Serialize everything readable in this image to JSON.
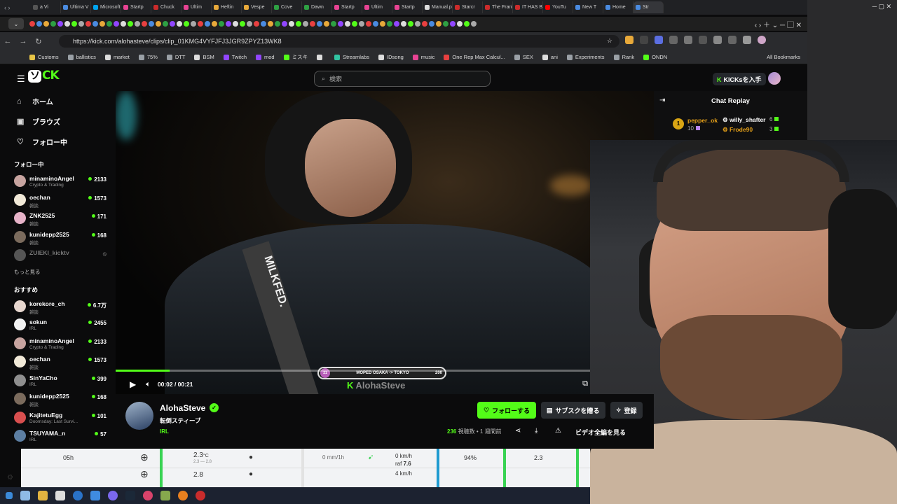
{
  "outer_tabs": [
    "a Vi",
    "Ultima V",
    "Microsoft",
    "Startp",
    "Chuck",
    "Ultim",
    "Heftin",
    "Vespe",
    "Cove",
    "Dawn",
    "Startp",
    "Ultim",
    "Startp",
    "Manual.p",
    "Starcr",
    "The Frank",
    "IT HAS B",
    "YouTu",
    "New T",
    "Home",
    "Str"
  ],
  "url": "https://kick.com/alohasteve/clips/clip_01KMG4VYFJFJ3JGR9ZPYZ13WK8",
  "bookmarks": [
    {
      "label": "Customs",
      "color": "#e8c547"
    },
    {
      "label": "ballistics",
      "color": "#9aa0a6"
    },
    {
      "label": "market",
      "color": "#dddddd"
    },
    {
      "label": "75%",
      "color": "#9aa0a6"
    },
    {
      "label": "DTT",
      "color": "#9aa0a6"
    },
    {
      "label": "BSM",
      "color": "#dddddd"
    },
    {
      "label": "Twitch",
      "color": "#9146ff"
    },
    {
      "label": "mod",
      "color": "#9146ff"
    },
    {
      "label": "ミスキ",
      "color": "#53fc18"
    },
    {
      "label": "",
      "color": "#dddddd"
    },
    {
      "label": "Streamlabs",
      "color": "#31c3a2"
    },
    {
      "label": "IDsong",
      "color": "#dddddd"
    },
    {
      "label": "music",
      "color": "#e84393"
    },
    {
      "label": "One Rep Max Calcul...",
      "color": "#e84040"
    },
    {
      "label": "SEX",
      "color": "#9aa0a6"
    },
    {
      "label": "ani",
      "color": "#dddddd"
    },
    {
      "label": "Experiments",
      "color": "#9aa0a6"
    },
    {
      "label": "Rank",
      "color": "#9aa0a6"
    },
    {
      "label": "ONDN",
      "color": "#53fc18"
    }
  ],
  "all_bookmarks": "All Bookmarks",
  "kick": {
    "search_placeholder": "検索",
    "get_kicks": "KICKsを入手"
  },
  "sidebar": {
    "nav": [
      {
        "icon": "home-icon",
        "label": "ホーム",
        "glyph": "⌂"
      },
      {
        "icon": "browse-icon",
        "label": "ブラウズ",
        "glyph": "▣"
      },
      {
        "icon": "heart-icon",
        "label": "フォロー中",
        "glyph": "♡"
      }
    ],
    "following_header": "フォロー中",
    "following": [
      {
        "name": "minaminoAngel",
        "category": "Crypto & Trading",
        "viewers": "2133",
        "color": "#c7a4a0"
      },
      {
        "name": "oechan",
        "category": "雑談",
        "viewers": "1573",
        "color": "#f1e9d8"
      },
      {
        "name": "ZNK2525",
        "category": "雑談",
        "viewers": "171",
        "color": "#e6b2c8"
      },
      {
        "name": "kunidepp2525",
        "category": "雑談",
        "viewers": "168",
        "color": "#7b6b5d"
      },
      {
        "name": "ZUIEKI_kicktv",
        "category": "",
        "viewers": "",
        "color": "#555555",
        "offline": true
      }
    ],
    "show_more": "もっと見る",
    "recommended_header": "おすすめ",
    "recommended": [
      {
        "name": "korekore_ch",
        "category": "雑談",
        "viewers": "6.7万",
        "color": "#e7d7cf"
      },
      {
        "name": "sokun",
        "category": "IRL",
        "viewers": "2455",
        "color": "#f2f2f2"
      },
      {
        "name": "minaminoAngel",
        "category": "Crypto & Trading",
        "viewers": "2133",
        "color": "#c7a4a0"
      },
      {
        "name": "oechan",
        "category": "雑談",
        "viewers": "1573",
        "color": "#f1e9d8"
      },
      {
        "name": "SinYaCho",
        "category": "IRL",
        "viewers": "399",
        "color": "#8f8f8f"
      },
      {
        "name": "kunidepp2525",
        "category": "雑談",
        "viewers": "168",
        "color": "#7b6b5d"
      },
      {
        "name": "KajitetuEgg",
        "category": "Doomsday: Last Survi...",
        "viewers": "101",
        "color": "#d94f4f"
      },
      {
        "name": "TSUYAMA_n",
        "category": "IRL",
        "viewers": "57",
        "color": "#5d7fa3"
      }
    ]
  },
  "video": {
    "current_time": "00:02",
    "duration": "00:21",
    "time_display": "00:02 / 00:21",
    "progress": 0.1,
    "overlay_route": "MOPED OSAKA -> TOKYO",
    "overlay_left": "21",
    "overlay_right": "200",
    "overlay_name": "AlohaSteve"
  },
  "chat": {
    "title": "Chat Replay",
    "gifters": [
      {
        "rank": "1",
        "name": "pepper_ok",
        "count": "10"
      },
      {
        "name": "willy_shafter",
        "count": "6"
      },
      {
        "name": "Frode90",
        "count": "3"
      }
    ]
  },
  "channel": {
    "name": "AlohaSteve",
    "title": "転倒スティーブ",
    "category": "IRL",
    "follow_label": "フォローする",
    "gift_label": "サブスクを贈る",
    "subscribe_label": "登録",
    "views": "236",
    "views_suffix": "視聴数",
    "age": "• 1 週間前",
    "full_video": "ビデオ全編を見る"
  },
  "weather": {
    "hour": "05h",
    "temp": "2.3",
    "temp_unit": "°C",
    "temp_range": "2.3 — 2.8",
    "precip": "0 mm/1h",
    "wind": "0 km/h",
    "gust_label": "raf",
    "gust": "7.6",
    "humidity": "94%",
    "dew": "2.3",
    "temp2": "2.8",
    "wind2": "4 km/h",
    "colors": {
      "green": "#39d353",
      "blue": "#1f9bd1"
    }
  }
}
